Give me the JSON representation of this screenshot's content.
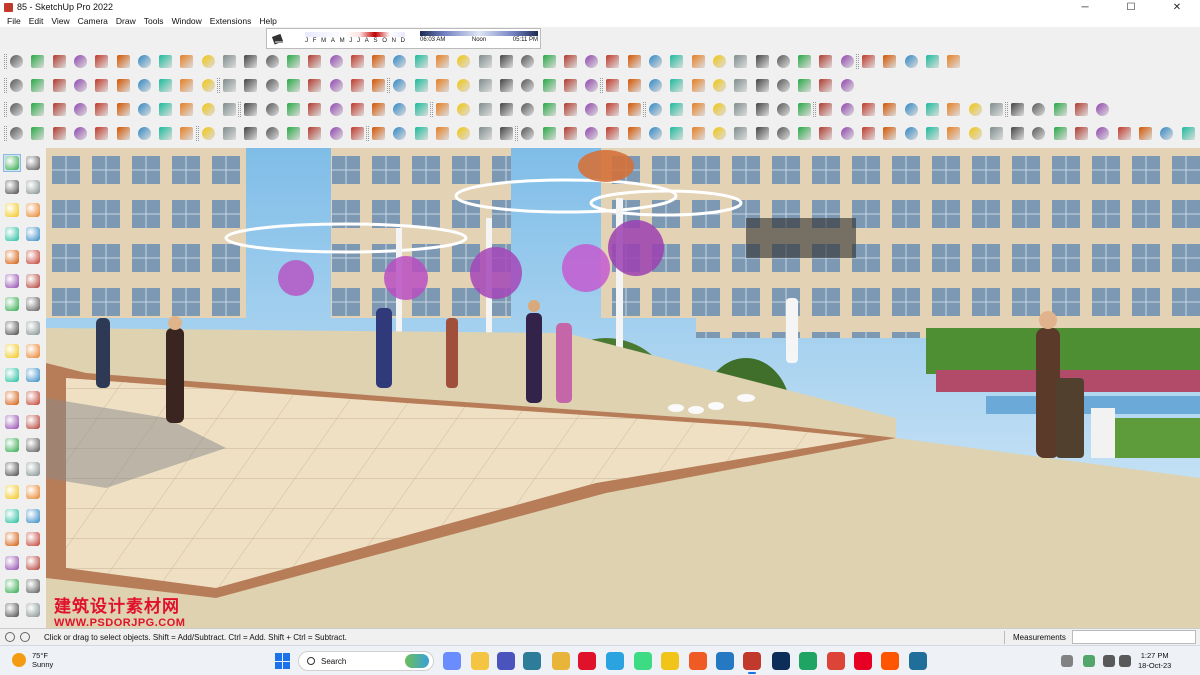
{
  "window": {
    "title": "85 - SketchUp Pro 2022",
    "minimize": "─",
    "maximize": "☐",
    "close": "✕"
  },
  "menu": [
    "File",
    "Edit",
    "View",
    "Camera",
    "Draw",
    "Tools",
    "Window",
    "Extensions",
    "Help"
  ],
  "shadows": {
    "months": [
      "J",
      "F",
      "M",
      "A",
      "M",
      "J",
      "J",
      "A",
      "S",
      "O",
      "N",
      "D"
    ],
    "time_start": "06:03 AM",
    "time_mid": "Noon",
    "time_end": "05:11 PM"
  },
  "viewport": {
    "watermark_cn": "建筑设计素材网",
    "watermark_url": "WWW.PSDORJPG.COM"
  },
  "status": {
    "message": "Click or drag to select objects. Shift = Add/Subtract. Ctrl = Add. Shift + Ctrl = Subtract.",
    "measurements_label": "Measurements",
    "measurements_value": ""
  },
  "taskbar": {
    "weather_temp": "75°F",
    "weather_desc": "Sunny",
    "search_label": "Search",
    "time": "1:27 PM",
    "date": "18-Oct-23"
  },
  "colors": {
    "accent": "#1a73e8",
    "sketchup_red": "#c0392b",
    "watermark": "#e0122b"
  }
}
